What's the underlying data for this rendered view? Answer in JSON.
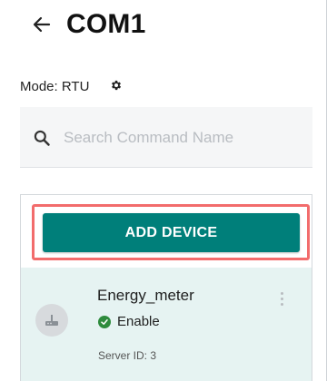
{
  "header": {
    "title": "COM1",
    "back_icon": "arrow-left-icon"
  },
  "mode": {
    "label": "Mode: RTU",
    "settings_icon": "gear-icon"
  },
  "search": {
    "placeholder": "Search Command Name",
    "value": "",
    "icon": "search-icon"
  },
  "devices_panel": {
    "add_button_label": "ADD DEVICE",
    "colors": {
      "button": "#007f7a",
      "highlight": "#f26c6c",
      "card_background": "#e6f3f2",
      "status_enabled": "#2e8b3d"
    },
    "devices": [
      {
        "name": "Energy_meter",
        "status": "Enable",
        "server_id": "Server ID: 3",
        "icon": "router-icon",
        "menu_icon": "kebab-menu-icon"
      }
    ]
  }
}
